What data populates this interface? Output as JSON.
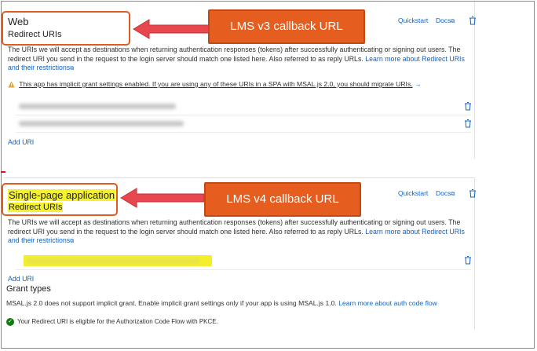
{
  "description": "The URIs we will accept as destinations when returning authentication responses (tokens) after successfully authenticating or signing out users. The redirect URI you send in the request to the login server should match one listed here. Also referred to as reply URLs.",
  "learn_more_redirect": "Learn more about Redirect URIs and their restrictions",
  "quickstart_label": "Quickstart",
  "docs_label": "Docs",
  "add_uri_label": "Add URI",
  "web": {
    "title": "Web",
    "subtitle": "Redirect URIs",
    "warning_text": "This app has implicit grant settings enabled. If you are using any of these URIs in a SPA with MSAL.js 2.0, you should migrate URIs.",
    "warning_arrow": "→"
  },
  "spa": {
    "title": "Single-page application",
    "subtitle": "Redirect URIs",
    "grant_title": "Grant types",
    "grant_desc": "MSAL.js 2.0 does not support implicit grant. Enable implicit grant settings only if your app is using MSAL.js 1.0.",
    "grant_link": "Learn more about auth code flow",
    "pkce_text": "Your Redirect URI is eligible for the Authorization Code Flow with PKCE."
  },
  "callouts": {
    "v3": "LMS v3 callback URL",
    "v4": "LMS v4 callback URL"
  },
  "colors": {
    "accent": "#0f62c4",
    "callout_bg": "#e55d1f",
    "highlight": "#f5f22a",
    "success": "#107c10",
    "warning": "#e8a21a"
  },
  "icons": [
    "trash-icon",
    "external-link-icon",
    "warning-icon",
    "check-circle-icon",
    "arrow-left-icon"
  ]
}
